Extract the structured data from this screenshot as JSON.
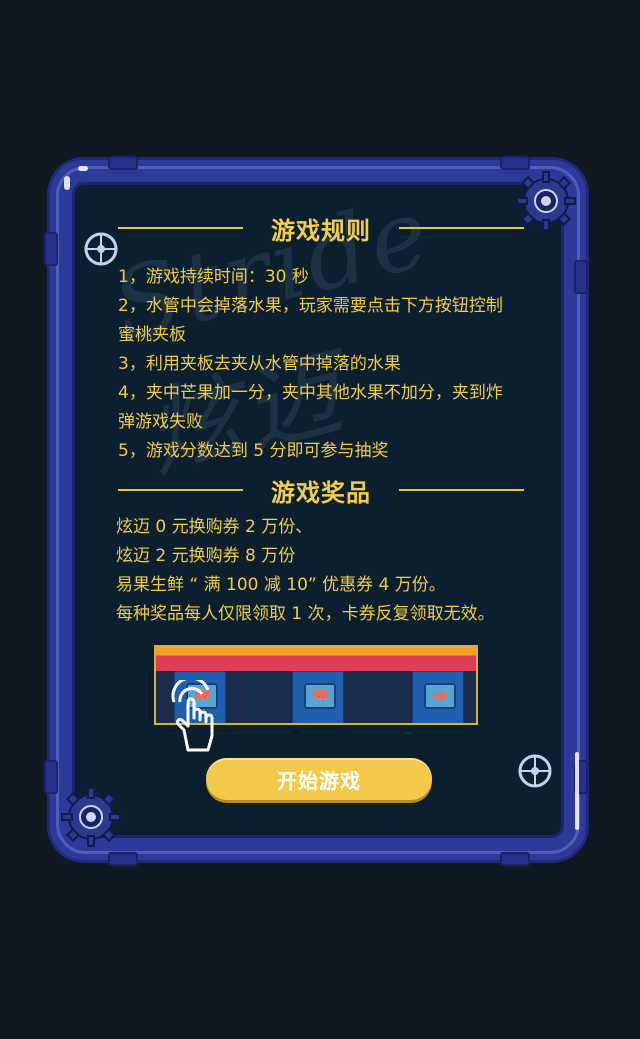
{
  "watermark": "Stride 炫迈",
  "rules": {
    "title": "游戏规则",
    "items": [
      "1，游戏持续时间：30 秒",
      "2，水管中会掉落水果，玩家需要点击下方按钮控制",
      "蜜桃夹板",
      "3，利用夹板去夹从水管中掉落的水果",
      "4，夹中芒果加一分，夹中其他水果不加分，夹到炸",
      "弹游戏失败",
      "5，游戏分数达到 5 分即可参与抽奖"
    ]
  },
  "prizes": {
    "title": "游戏奖品",
    "items": [
      "炫迈 0 元换购券 2 万份、",
      "炫迈 2 元换购券 8 万份",
      "易果生鲜 “ 满 100 减 10” 优惠券 4 万份。",
      "每种奖品每人仅限领取 1 次，卡券反复领取无效。"
    ]
  },
  "start_button": "开始游戏",
  "colors": {
    "accent": "#f3cd4b",
    "pipe": "#2e3a99",
    "panel": "#0c1f2e",
    "background": "#0f1921"
  },
  "icons": [
    "gear-icon",
    "valve-wheel-icon",
    "hand-pointer-icon",
    "stop-icon",
    "arrow-right-icon"
  ]
}
